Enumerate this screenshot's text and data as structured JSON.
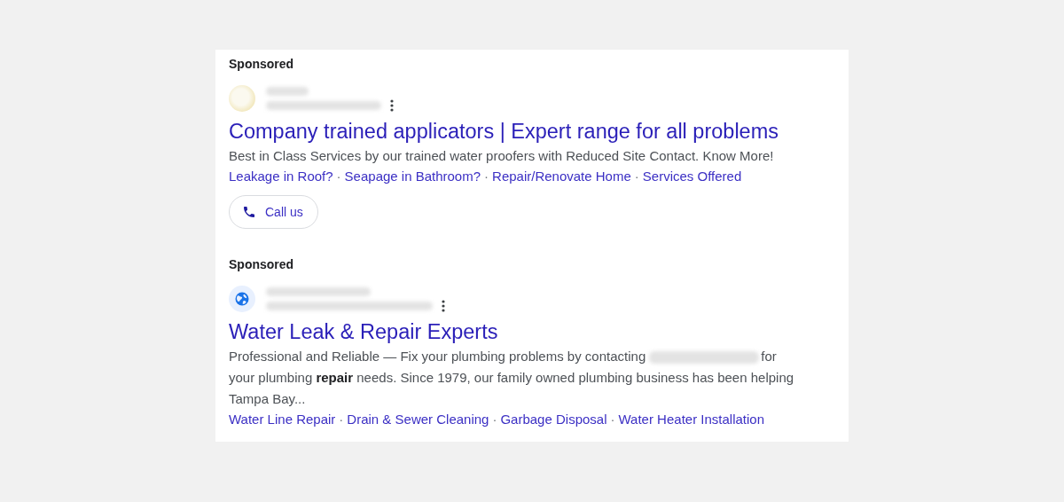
{
  "ads": [
    {
      "label": "Sponsored",
      "kind": "favicon",
      "title": "Company trained applicators | Expert range for all problems",
      "description": [
        {
          "kind": "text",
          "text": "Best in Class Services by our trained water proofers with Reduced Site Contact. Know More!"
        }
      ],
      "separator": "·",
      "sitelinks": [
        "Leakage in Roof?",
        "Seapage in Bathroom?",
        "Repair/Renovate Home",
        "Services Offered"
      ],
      "call_button": "Call us"
    },
    {
      "label": "Sponsored",
      "kind": "globe",
      "title": "Water Leak & Repair Experts",
      "description": [
        {
          "kind": "text",
          "text": "Professional and Reliable — Fix your plumbing problems by contacting"
        },
        {
          "kind": "redacted"
        },
        {
          "kind": "text",
          "text": "for"
        },
        {
          "kind": "line",
          "text": "your plumbing **repair** needs. Since 1979, our family owned plumbing business has been helping Tampa Bay..."
        }
      ],
      "separator": "·",
      "sitelinks": [
        "Water Line Repair",
        "Drain & Sewer Cleaning",
        "Garbage Disposal",
        "Water Heater Installation"
      ]
    }
  ]
}
